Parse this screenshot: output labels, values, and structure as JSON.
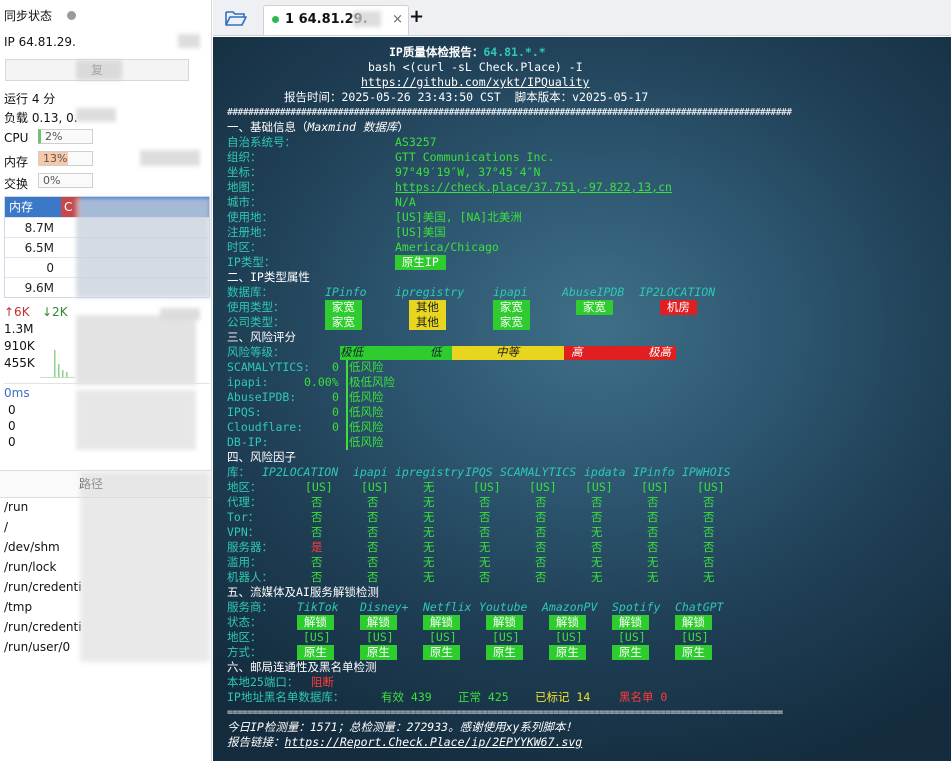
{
  "sidebar": {
    "sync_label": "同步状态",
    "ip_label": "IP",
    "ip_value": "64.81.29.",
    "copy_btn": "复",
    "uptime": "运行 4 分",
    "load": "负载 0.13, 0.",
    "cpu_label": "CPU",
    "cpu_value": "2%",
    "mem_label": "内存",
    "mem_value": "13%",
    "swap_label": "交换",
    "swap_value": "0%",
    "proc_header": "内存",
    "proc_header2": "C",
    "proc_rows": [
      "8.7M",
      "6.5M",
      "0",
      "9.6M"
    ],
    "net_up": "↑6K",
    "net_down": "↓2K",
    "net_vals": [
      "1.3M",
      "910K",
      "455K"
    ],
    "ping": "0ms",
    "ping_vals": [
      "0",
      "0",
      "0"
    ],
    "path_header": "路径",
    "paths": [
      "/run",
      "/",
      "/dev/shm",
      "/run/lock",
      "/run/credenti",
      "/tmp",
      "/run/credenti",
      "/run/user/0"
    ]
  },
  "tabbar": {
    "tab_label": "1 64.81.29.",
    "close": "×",
    "plus": "+"
  },
  "term": {
    "l1a": "IP质量体检报告：",
    "l1b": "64.81.*.*",
    "l2": "bash <(curl -sL Check.Place) -I",
    "l3": "https://github.com/xykt/IPQuality",
    "l4": "报告时间：2025-05-26 23:43:50 CST  脚本版本：v2025-05-17",
    "hash": "###########################################################################################################",
    "s1": "一、基础信息（",
    "s1i": "Maxmind 数据库",
    "s1e": "）",
    "asn_k": "自治系统号：",
    "asn_v": "AS3257",
    "org_k": "组织：",
    "org_v": "GTT Communications Inc.",
    "coord_k": "坐标：",
    "coord_v": "97°49′19″W, 37°45′4″N",
    "map_k": "地图：",
    "map_v": "https://check.place/37.751,-97.822,13,cn",
    "city_k": "城市：",
    "city_v": "N/A",
    "use_k": "使用地：",
    "use_v": "[US]美国, [NA]北美洲",
    "reg_k": "注册地：",
    "reg_v": "[US]美国",
    "tz_k": "时区：",
    "tz_v": "America/Chicago",
    "type_k": "IP类型：",
    "type_v": " 原生IP ",
    "s2": "二、IP类型属性",
    "db_k": "数据库：",
    "dbs": [
      "IPinfo",
      "ipregistry",
      "ipapi",
      "AbuseIPDB",
      "IP2LOCATION"
    ],
    "use2_k": "使用类型：",
    "use2": [
      " 家宽 ",
      " 其他 ",
      " 家宽 ",
      " 家宽 ",
      " 机房 "
    ],
    "com_k": "公司类型：",
    "com": [
      " 家宽 ",
      " 其他 ",
      " 家宽 "
    ],
    "s3": "三、风险评分",
    "lvl_k": "风险等级：",
    "lvl": [
      "极低",
      "低",
      "中等",
      "高",
      "极高"
    ],
    "risk": [
      [
        "SCAMALYTICS:",
        "0",
        "低风险"
      ],
      [
        "ipapi:",
        "0.00%",
        "极低风险"
      ],
      [
        "AbuseIPDB:",
        "0",
        "低风险"
      ],
      [
        "IPQS:",
        "0",
        "低风险"
      ],
      [
        "Cloudflare:",
        "0",
        "低风险"
      ],
      [
        "DB-IP:",
        "",
        "低风险"
      ]
    ],
    "s4": "四、风险因子",
    "lib_k": "库：",
    "libs": [
      "IP2LOCATION",
      "ipapi",
      "ipregistry",
      "IPQS",
      "SCAMALYTICS",
      "ipdata",
      "IPinfo",
      "IPWHOIS"
    ],
    "factors": [
      [
        "地区：",
        "[US]",
        "[US]",
        "无",
        "[US]",
        "[US]",
        "[US]",
        "[US]",
        "[US]"
      ],
      [
        "代理：",
        "否",
        "否",
        "无",
        "否",
        "否",
        "否",
        "否",
        "否"
      ],
      [
        "Tor：",
        "否",
        "否",
        "无",
        "否",
        "否",
        "否",
        "否",
        "否"
      ],
      [
        "VPN：",
        "否",
        "否",
        "无",
        "否",
        "否",
        "无",
        "否",
        "否"
      ],
      [
        "服务器：",
        "是",
        "否",
        "无",
        "无",
        "否",
        "否",
        "否",
        "否"
      ],
      [
        "滥用：",
        "否",
        "否",
        "无",
        "无",
        "否",
        "无",
        "无",
        "否"
      ],
      [
        "机器人：",
        "否",
        "否",
        "无",
        "否",
        "否",
        "无",
        "无",
        "无"
      ]
    ],
    "s5": "五、流媒体及AI服务解锁检测",
    "svc_k": "服务商：",
    "svcs": [
      "TikTok",
      "Disney+",
      "Netflix",
      "Youtube",
      "AmazonPV",
      "Spotify",
      "ChatGPT"
    ],
    "st_k": "状态：",
    "st": " 解锁 ",
    "rg_k": "地区：",
    "rg": "[US]",
    "md_k": "方式：",
    "md": " 原生 ",
    "s6": "六、邮局连通性及黑名单检测",
    "p25_k": "本地25端口：",
    "p25_v": "阻断",
    "bl_k": "IP地址黑名单数据库：",
    "bl_valid": "有效 439",
    "bl_ok": "正常 425",
    "bl_mark": "已标记 14",
    "bl_black": "黑名单 0",
    "eq": "=============================================================================================================",
    "today": "今日IP检测量：1571；总检测量：272933。感谢使用xy系列脚本！",
    "link_k": "报告链接：",
    "link_v": "https://Report.Check.Place/ip/2EPYYKW67.svg"
  }
}
